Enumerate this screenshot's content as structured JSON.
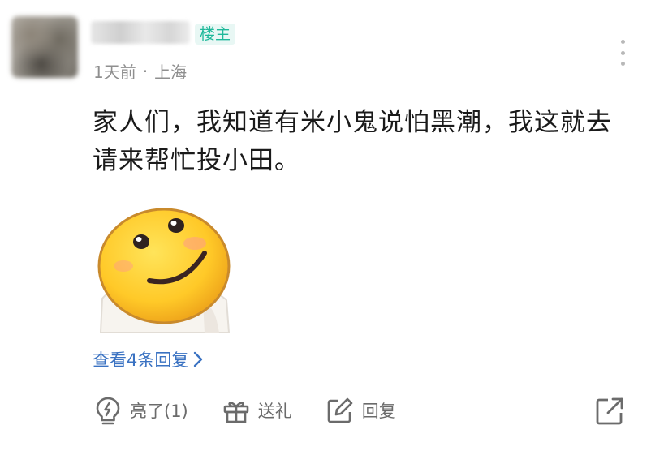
{
  "comment": {
    "username": "",
    "op_badge": "楼主",
    "time": "1天前",
    "separator": "·",
    "location": "上海",
    "content": "家人们，我知道有米小鬼说怕黑潮，我这就去请来帮忙投小田。",
    "view_replies": "查看4条回复",
    "actions": {
      "like": "亮了(1)",
      "gift": "送礼",
      "reply": "回复"
    }
  },
  "colors": {
    "badge_text": "#1fb89a",
    "badge_bg": "#e8f7f4",
    "link": "#3a72c2",
    "meta": "#8f8f8f",
    "action": "#6b6b6b"
  },
  "icons": [
    "more-vertical-icon",
    "chevron-right-icon",
    "lightbulb-icon",
    "gift-icon",
    "edit-icon",
    "share-icon"
  ]
}
